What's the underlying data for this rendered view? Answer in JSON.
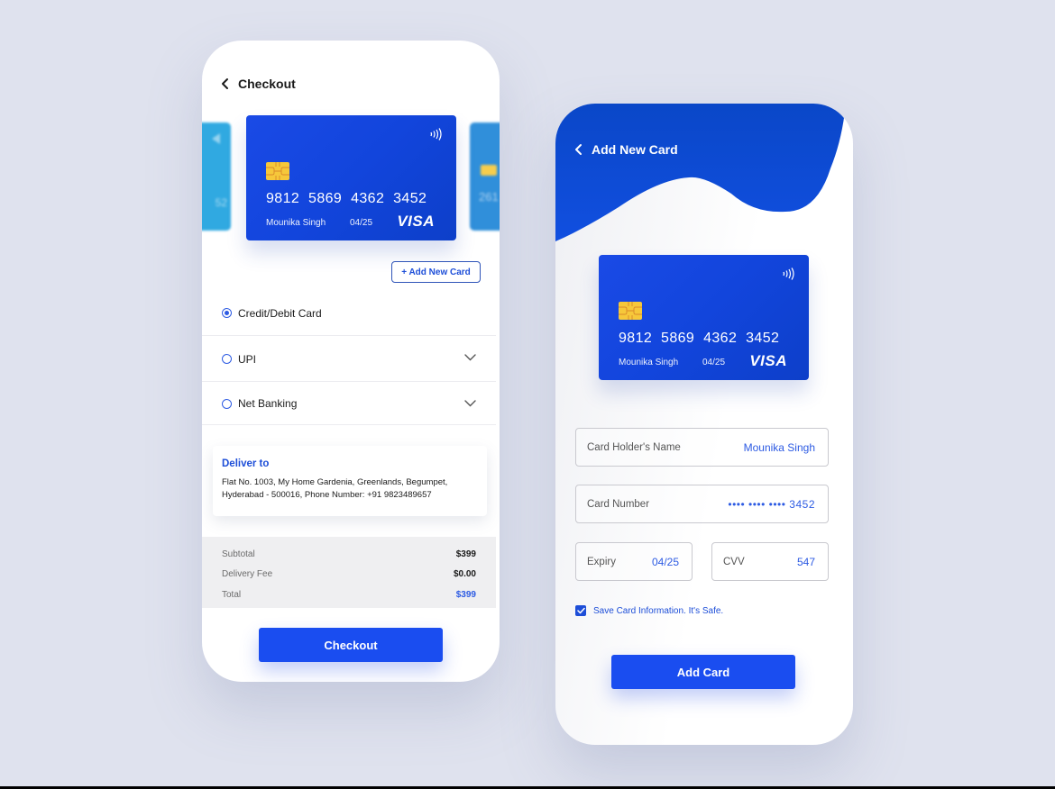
{
  "checkout_screen": {
    "title": "Checkout",
    "back_icon": "chevron-left-icon",
    "card": {
      "number": "9812  5869  4362  3452",
      "holder": "Mounika Singh",
      "expiry": "04/25",
      "brand": "VISA",
      "contactless_icon": "nfc-icon",
      "chip_icon": "chip-icon"
    },
    "side_cards": {
      "left_number_fragment": "52",
      "right_number_fragment": "261"
    },
    "add_new_card_label": "+ Add New Card",
    "payment_options": [
      {
        "label": "Credit/Debit Card",
        "selected": true,
        "expandable": false
      },
      {
        "label": "UPI",
        "selected": false,
        "expandable": true
      },
      {
        "label": "Net Banking",
        "selected": false,
        "expandable": true
      }
    ],
    "deliver": {
      "title": "Deliver to",
      "address": "Flat No. 1003, My Home Gardenia, Greenlands, Begumpet, Hyderabad - 500016, Phone Number: +91 9823489657"
    },
    "summary": [
      {
        "label": "Subtotal",
        "value": "$399"
      },
      {
        "label": "Delivery Fee",
        "value": "$0.00"
      },
      {
        "label": "Total",
        "value": "$399"
      }
    ],
    "checkout_button": "Checkout"
  },
  "add_card_screen": {
    "title": "Add New Card",
    "back_icon": "chevron-left-icon",
    "card": {
      "number": "9812  5869  4362  3452",
      "holder": "Mounika Singh",
      "expiry": "04/25",
      "brand": "VISA"
    },
    "fields": {
      "holder_name": {
        "label": "Card Holder's Name",
        "value": "Mounika Singh"
      },
      "card_number": {
        "label": "Card Number",
        "value": "•••• •••• ••••  3452"
      },
      "expiry": {
        "label": "Expiry",
        "value": "04/25"
      },
      "cvv": {
        "label": "CVV",
        "value": "547"
      }
    },
    "save_card": {
      "label": "Save Card Information. It's Safe.",
      "checked": true
    },
    "add_card_button": "Add Card"
  },
  "colors": {
    "accent": "#1a4df0",
    "link_blue": "#1d4ed8",
    "background": "#dfe2ee",
    "card_blue": "#1245dc",
    "chip": "#f6c83a"
  }
}
